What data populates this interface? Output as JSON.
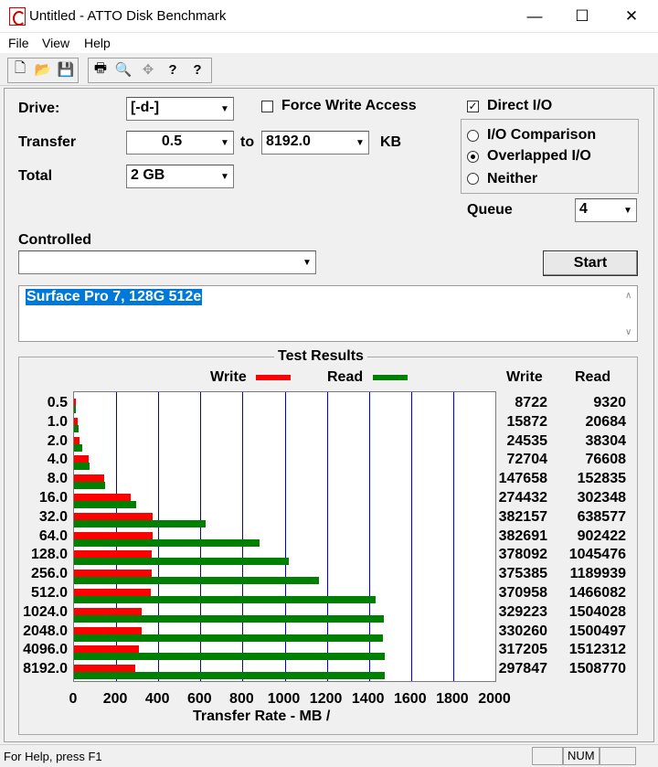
{
  "window": {
    "title": "Untitled - ATTO Disk Benchmark",
    "min_glyph": "—",
    "max_glyph": "☐",
    "close_glyph": "✕"
  },
  "menu": [
    "File",
    "View",
    "Help"
  ],
  "toolbar": {
    "icons": [
      "new-file-icon",
      "open-folder-icon",
      "save-icon",
      "print-icon",
      "print-preview-icon",
      "move-icon",
      "help-icon",
      "context-help-icon"
    ],
    "glyphs": [
      "🗋",
      "📂",
      "💾",
      "🖶",
      "🔍",
      "✥",
      "?",
      "?"
    ]
  },
  "settings": {
    "drive_label": "Drive:",
    "drive_value": "[-d-]",
    "transfer_label": "Transfer",
    "transfer_from": "0.5",
    "transfer_to_label": "to",
    "transfer_to": "8192.0",
    "transfer_unit": "KB",
    "total_label": "Total",
    "total_value": "2 GB",
    "force_write_label": "Force Write Access",
    "force_write_checked": false,
    "direct_io_label": "Direct I/O",
    "direct_io_checked": true,
    "direct_io_mark": "✓",
    "io_options": [
      "I/O Comparison",
      "Overlapped I/O",
      "Neither"
    ],
    "io_selected": 1,
    "queue_label": "Queue",
    "queue_value": "4",
    "controlled_label": "Controlled",
    "controlled_value": "",
    "start_label": "Start",
    "description": "Surface Pro 7, 128G 512e",
    "scroll_up": "∧",
    "scroll_down": "∨",
    "combo_arrow": "▼"
  },
  "results": {
    "title": "Test Results",
    "write_col": "Write",
    "read_col": "Read"
  },
  "chart_data": {
    "type": "bar",
    "orientation": "horizontal",
    "title": "Test Results",
    "xlabel": "Transfer Rate - MB /",
    "xlim": [
      0,
      2000
    ],
    "xticks": [
      0,
      200,
      400,
      600,
      800,
      1000,
      1200,
      1400,
      1600,
      1800,
      2000
    ],
    "grid": true,
    "legend_placement": "top",
    "categories": [
      "0.5",
      "1.0",
      "2.0",
      "4.0",
      "8.0",
      "16.0",
      "32.0",
      "64.0",
      "128.0",
      "256.0",
      "512.0",
      "1024.0",
      "2048.0",
      "4096.0",
      "8192.0"
    ],
    "series": [
      {
        "name": "Write",
        "color": "#ff0000",
        "values": [
          8.5,
          15.5,
          24.0,
          71.0,
          144.2,
          268.0,
          373.2,
          373.7,
          369.2,
          366.6,
          362.3,
          321.5,
          322.5,
          309.8,
          290.9
        ],
        "labels": [
          "8722",
          "15872",
          "24535",
          "72704",
          "147658",
          "274432",
          "382157",
          "382691",
          "378092",
          "375385",
          "370958",
          "329223",
          "330260",
          "317205",
          "297847"
        ]
      },
      {
        "name": "Read",
        "color": "#008000",
        "values": [
          9.1,
          20.2,
          37.4,
          74.8,
          149.3,
          295.3,
          623.6,
          881.3,
          1020.97,
          1162.05,
          1431.7,
          1468.8,
          1465.3,
          1476.9,
          1473.4
        ],
        "labels": [
          "9320",
          "20684",
          "38304",
          "76608",
          "152835",
          "302348",
          "638577",
          "902422",
          "1045476",
          "1189939",
          "1466082",
          "1504028",
          "1500497",
          "1512312",
          "1508770"
        ]
      }
    ]
  },
  "status": {
    "help_text": "For Help, press F1",
    "num_text": "NUM"
  }
}
